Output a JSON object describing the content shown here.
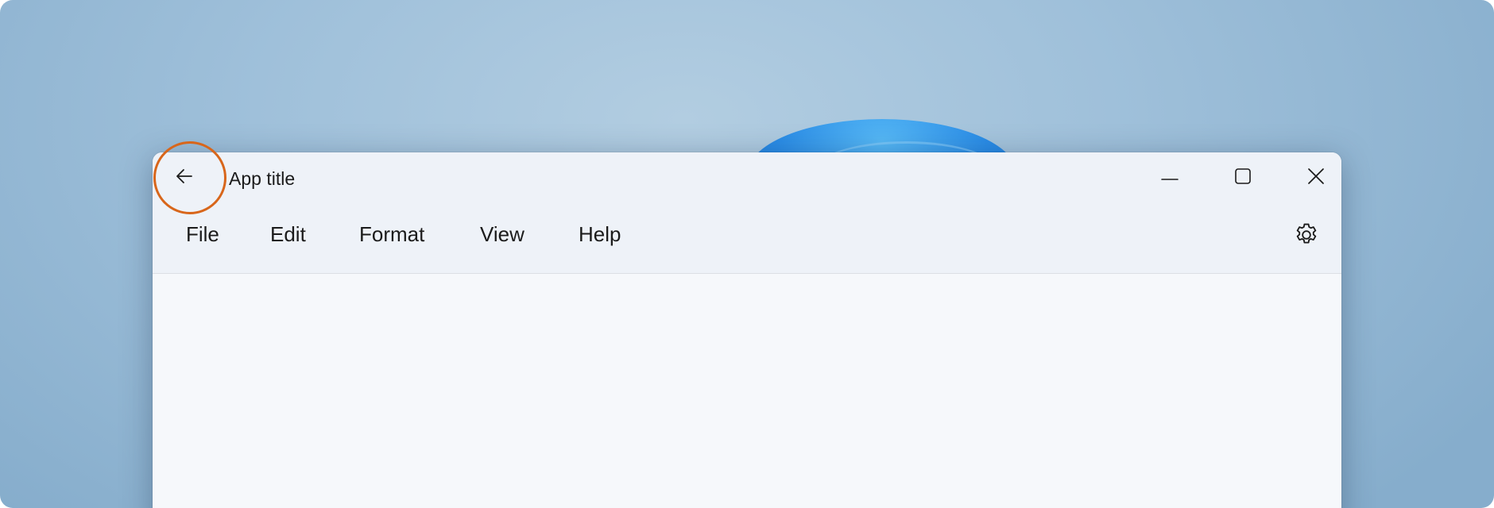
{
  "window": {
    "title": "App title"
  },
  "titlebar": {
    "back_icon": "back-arrow-icon",
    "caption_buttons": [
      {
        "name": "minimize",
        "icon": "minimize-icon"
      },
      {
        "name": "maximize",
        "icon": "maximize-icon"
      },
      {
        "name": "close",
        "icon": "close-icon"
      }
    ]
  },
  "menubar": {
    "items": [
      {
        "label": "File"
      },
      {
        "label": "Edit"
      },
      {
        "label": "Format"
      },
      {
        "label": "View"
      },
      {
        "label": "Help"
      }
    ],
    "settings_icon": "gear-icon"
  },
  "colors": {
    "highlight_ring": "#d8661b",
    "titlebar_bg": "#eef2f8",
    "content_bg": "#f6f8fb",
    "wallpaper_accent": "#2a8ce6"
  }
}
